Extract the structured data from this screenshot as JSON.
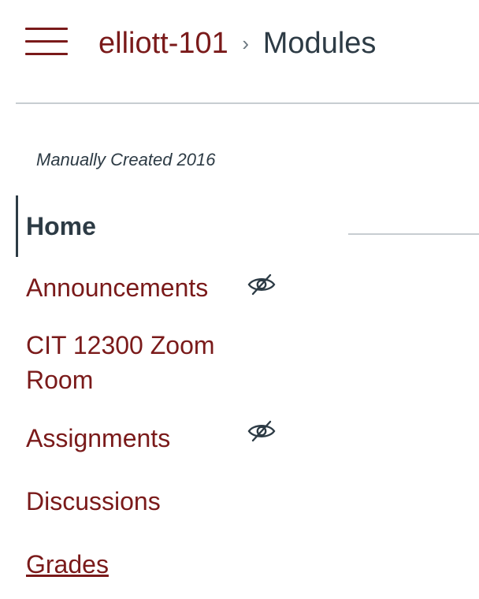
{
  "header": {
    "course_link": "elliott-101",
    "separator": "›",
    "current_page": "Modules"
  },
  "term": "Manually Created 2016",
  "nav": {
    "items": [
      {
        "label": "Home",
        "active": true,
        "hidden_icon": false
      },
      {
        "label": "Announcements",
        "active": false,
        "hidden_icon": true
      },
      {
        "label": "CIT 12300 Zoom Room",
        "active": false,
        "hidden_icon": false
      },
      {
        "label": "Assignments",
        "active": false,
        "hidden_icon": true
      },
      {
        "label": "Discussions",
        "active": false,
        "hidden_icon": false
      },
      {
        "label": "Grades",
        "active": false,
        "hidden_icon": false
      }
    ]
  },
  "icons": {
    "menu": "hamburger-menu-icon",
    "hidden": "eye-slash-icon"
  },
  "colors": {
    "link": "#7a1a1a",
    "text": "#2d3b45",
    "divider": "#c7cdd1"
  }
}
